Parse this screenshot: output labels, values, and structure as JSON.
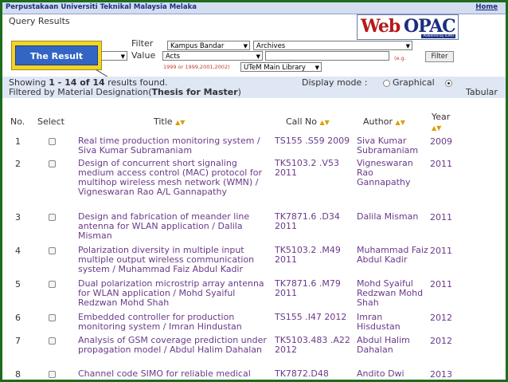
{
  "header": {
    "library_name": "Perpustakaan Universiti Teknikal Malaysia Melaka",
    "home": "Home",
    "page_title": "Query Results",
    "logo_web": "Web",
    "logo_opac": "OPAC",
    "logo_powered": "Powered by ILMU"
  },
  "callout": {
    "label": "The Result"
  },
  "filter": {
    "filter_label": "Filter",
    "value_label": "Value",
    "field_select": "Kampus Bandar",
    "archive_select": "Archives",
    "value_select": "Acts",
    "year_hint": "1999 or 1999,2001,2002)",
    "eg_hint": "(e.g.",
    "location_select": "UTeM Main Library",
    "filter_button": "Filter"
  },
  "summary": {
    "showing_prefix": "Showing ",
    "range": "1 - 14 of 14",
    "showing_suffix": " results found.",
    "filtered_prefix": "Filtered by Material Designation(",
    "designation": "Thesis for Master",
    "filtered_suffix": ")",
    "display_mode": "Display mode :",
    "graphical": "Graphical",
    "tabular": "Tabular"
  },
  "table": {
    "headers": {
      "no": "No.",
      "select": "Select",
      "title": "Title",
      "callno": "Call No",
      "author": "Author",
      "year": "Year"
    },
    "sort_icon": "▲▼",
    "rows": [
      {
        "no": "1",
        "title": "Real time production monitoring system / Siva Kumar Subramaniam",
        "callno": "TS155 .S59 2009",
        "author": "Siva Kumar Subramaniam",
        "year": "2009"
      },
      {
        "no": "2",
        "title": "Design of concurrent short signaling medium access control (MAC) protocol for multihop wireless mesh network (WMN) / Vigneswaran Rao A/L Gannapathy",
        "callno": "TK5103.2 .V53 2011",
        "author": "Vigneswaran Rao Gannapathy",
        "year": "2011"
      },
      {
        "no": "3",
        "title": "Design and fabrication of meander line antenna for WLAN application / Dalila Misman",
        "callno": "TK7871.6 .D34 2011",
        "author": "Dalila Misman",
        "year": "2011"
      },
      {
        "no": "4",
        "title": "Polarization diversity in multiple input multiple output wireless communication system / Muhammad Faiz Abdul Kadir",
        "callno": "TK5103.2 .M49 2011",
        "author": "Muhammad Faiz Abdul Kadir",
        "year": "2011"
      },
      {
        "no": "5",
        "title": "Dual polarization microstrip array antenna for WLAN application / Mohd Syaiful Redzwan Mohd Shah",
        "callno": "TK7871.6 .M79 2011",
        "author": "Mohd Syaiful Redzwan Mohd Shah",
        "year": "2011"
      },
      {
        "no": "6",
        "title": "Embedded controller for production monitoring system / Imran Hindustan",
        "callno": "TS155 .I47 2012",
        "author": "Imran Hisdustan",
        "year": "2012"
      },
      {
        "no": "7",
        "title": "Analysis of GSM coverage prediction under propagation model / Abdul Halim Dahalan",
        "callno": "TK5103.483 .A22 2012",
        "author": "Abdul Halim Dahalan",
        "year": "2012"
      },
      {
        "no": "8",
        "title": "Channel code SIMO for reliable medical",
        "callno": "TK7872.D48",
        "author": "Andito Dwi",
        "year": "2013"
      }
    ]
  }
}
